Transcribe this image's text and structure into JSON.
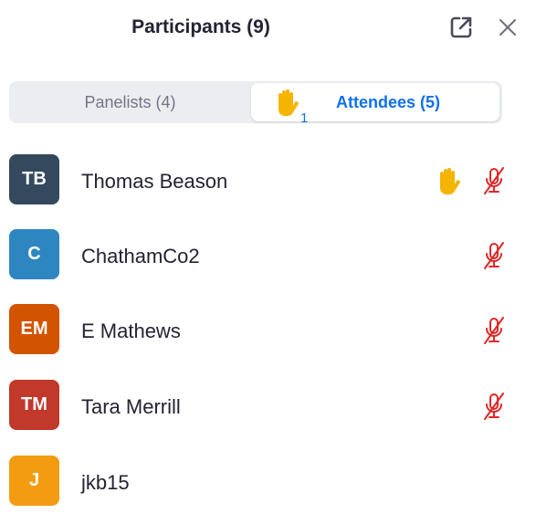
{
  "header": {
    "title": "Participants (9)",
    "popout_icon": "popout-icon",
    "close_icon": "close-icon"
  },
  "tabs": {
    "panelists_label": "Panelists (4)",
    "attendees_label": "Attendees (5)",
    "raised_hands_count": "1",
    "active_tab": "attendees"
  },
  "participants": [
    {
      "initials": "TB",
      "name": "Thomas Beason",
      "avatar_color": "#34495e",
      "hand_raised": true,
      "muted": true
    },
    {
      "initials": "C",
      "name": "ChathamCo2",
      "avatar_color": "#2e86c1",
      "hand_raised": false,
      "muted": true
    },
    {
      "initials": "EM",
      "name": "E Mathews",
      "avatar_color": "#d35400",
      "hand_raised": false,
      "muted": true
    },
    {
      "initials": "TM",
      "name": "Tara Merrill",
      "avatar_color": "#c0392b",
      "hand_raised": false,
      "muted": true
    },
    {
      "initials": "J",
      "name": "jkb15",
      "avatar_color": "#f39c12",
      "hand_raised": false,
      "muted": false
    }
  ],
  "colors": {
    "accent": "#0e71eb",
    "muted_mic": "#e02828",
    "hand": "#f5b400",
    "tab_bg": "#ebedf1"
  }
}
